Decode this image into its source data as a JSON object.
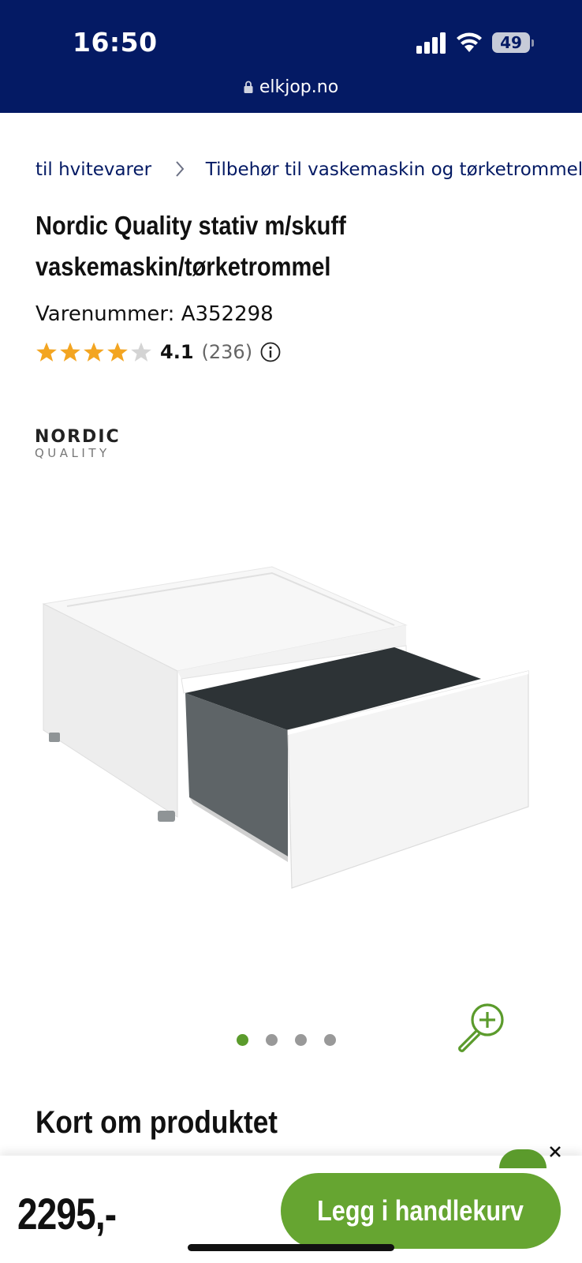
{
  "status_bar": {
    "time": "16:50",
    "battery_level": "49",
    "url": "elkjop.no",
    "background_color": "#041a64"
  },
  "breadcrumb": {
    "items": [
      "til hvitevarer",
      "Tilbehør til vaskemaskin og tørketrommel"
    ]
  },
  "product": {
    "title_line1": "Nordic Quality stativ m/skuff",
    "title_line2": "vaskemaskin/tørketrommel",
    "sku_label": "Varenummer:",
    "sku_value": "A352298",
    "rating_value": "4.1",
    "rating_count": "(236)",
    "rating_stars_filled": 4,
    "rating_stars_total": 5,
    "brand_logo": "NORDIC QUALITY"
  },
  "gallery": {
    "image_count": 4,
    "active_index": 0,
    "zoom_icon": "zoom-in-icon"
  },
  "section": {
    "heading": "Kort om produktet"
  },
  "purchase": {
    "price": "2295,-",
    "add_to_cart_label": "Legg i handlekurv",
    "button_color": "#66a531"
  }
}
